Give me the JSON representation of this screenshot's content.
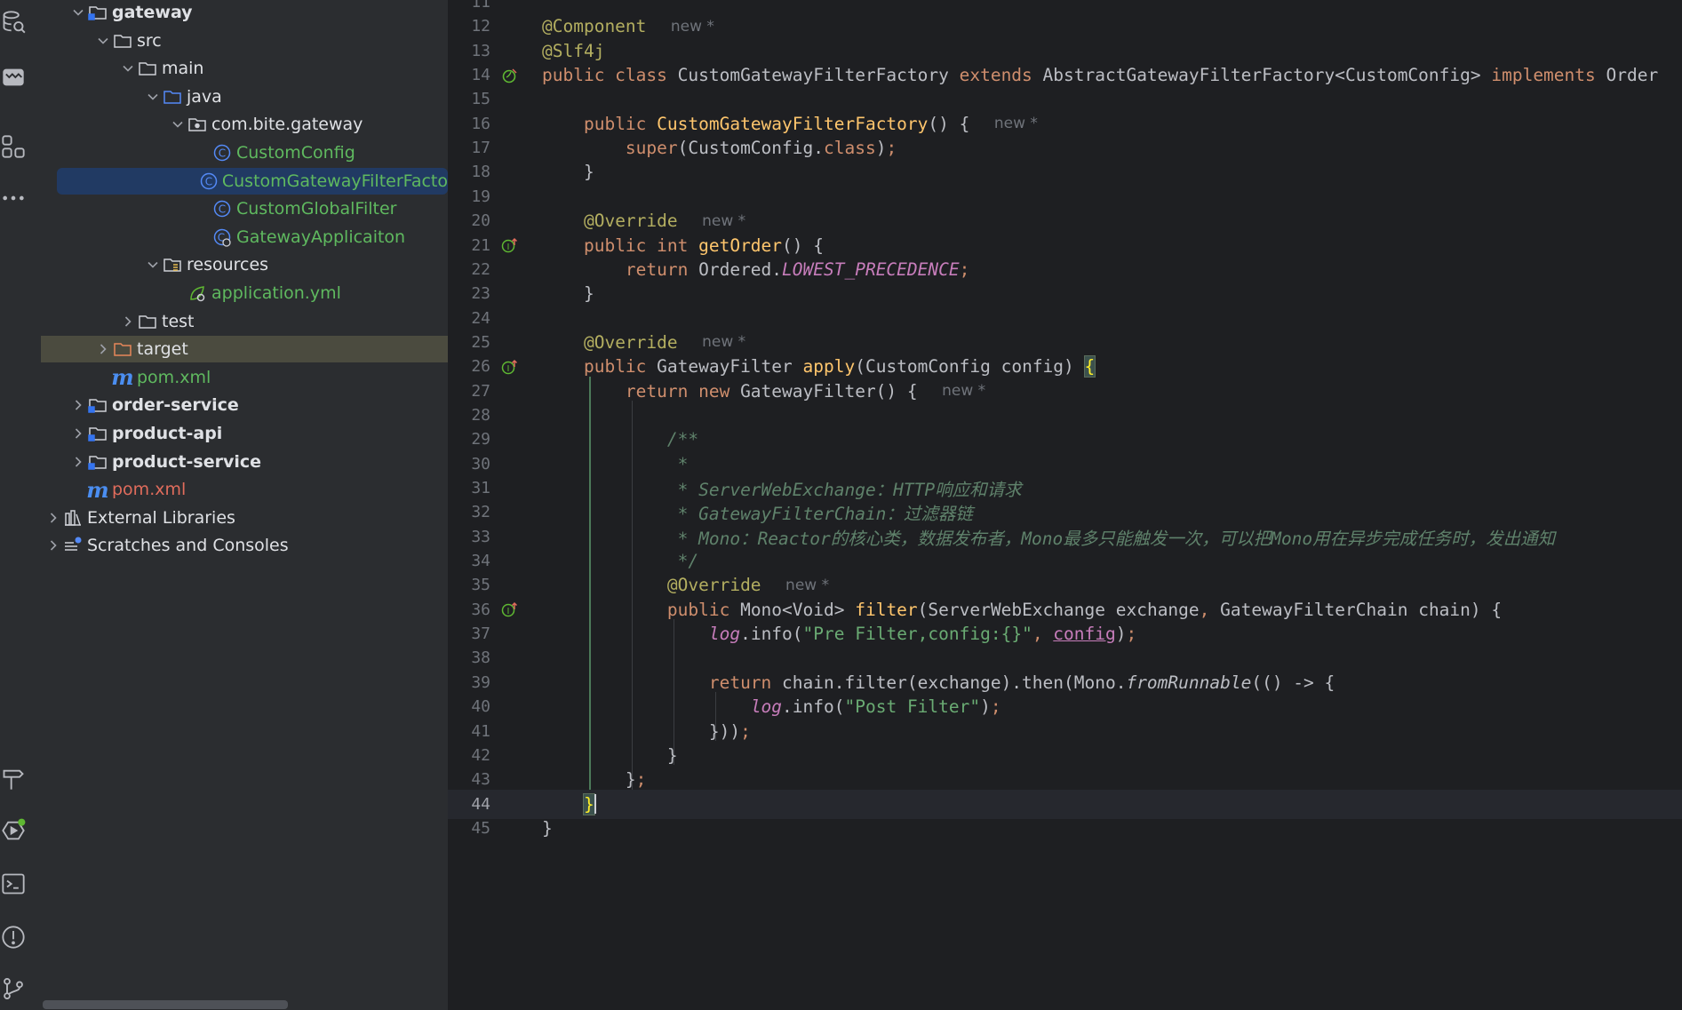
{
  "stripe": {
    "top_icons": [
      "database-icon",
      "ai-assistant-icon",
      "structure-icon",
      "more-icon"
    ],
    "bottom_icons": [
      "build-icon",
      "services-icon",
      "terminal-icon",
      "problems-icon",
      "git-icon"
    ]
  },
  "project_tree": [
    {
      "label": "gateway",
      "chev": "open",
      "icon": "module-folder-icon",
      "style": "bold"
    },
    {
      "label": "src",
      "chev": "open",
      "icon": "folder-icon"
    },
    {
      "label": "main",
      "chev": "open",
      "icon": "folder-icon"
    },
    {
      "label": "java",
      "chev": "open",
      "icon": "source-folder-icon"
    },
    {
      "label": "com.bite.gateway",
      "chev": "open",
      "icon": "package-icon"
    },
    {
      "label": "CustomConfig",
      "icon": "class-icon",
      "style": "green"
    },
    {
      "label": "CustomGatewayFilterFacto",
      "icon": "class-icon",
      "style": "green",
      "selected": true
    },
    {
      "label": "CustomGlobalFilter",
      "icon": "class-icon",
      "style": "green"
    },
    {
      "label": "GatewayApplicaiton",
      "icon": "spring-boot-class-icon",
      "style": "green"
    },
    {
      "label": "resources",
      "chev": "open",
      "icon": "resources-folder-icon"
    },
    {
      "label": "application.yml",
      "icon": "spring-yml-icon",
      "style": "green"
    },
    {
      "label": "test",
      "chev": "closed",
      "icon": "folder-icon"
    },
    {
      "label": "target",
      "chev": "closed",
      "icon": "excluded-folder-icon",
      "highlight": true
    },
    {
      "label": "pom.xml",
      "icon": "maven-icon",
      "style": "green"
    },
    {
      "label": "order-service",
      "chev": "closed",
      "icon": "module-folder-icon",
      "style": "bold"
    },
    {
      "label": "product-api",
      "chev": "closed",
      "icon": "module-folder-icon",
      "style": "bold"
    },
    {
      "label": "product-service",
      "chev": "closed",
      "icon": "module-folder-icon",
      "style": "bold"
    },
    {
      "label": "pom.xml",
      "icon": "maven-icon",
      "style": "red"
    },
    {
      "label": "External Libraries",
      "chev": "closed",
      "icon": "libraries-icon"
    },
    {
      "label": "Scratches and Consoles",
      "chev": "closed",
      "icon": "scratches-icon"
    }
  ],
  "editor": {
    "current_line": 44,
    "lines": [
      {
        "n": "11",
        "t": []
      },
      {
        "n": "12",
        "t": [
          [
            "ann",
            "@Component"
          ],
          [
            "sp",
            "  "
          ],
          [
            "hint",
            "new *"
          ]
        ]
      },
      {
        "n": "13",
        "t": [
          [
            "ann",
            "@Slf4j"
          ]
        ]
      },
      {
        "n": "14",
        "g": "bean-icon",
        "t": [
          [
            "kw",
            "public class "
          ],
          [
            "id",
            "CustomGatewayFilterFactory "
          ],
          [
            "kw",
            "extends "
          ],
          [
            "id",
            "AbstractGatewayFilterFactory<CustomConfig> "
          ],
          [
            "kw",
            "implements "
          ],
          [
            "id",
            "Order"
          ]
        ]
      },
      {
        "n": "15",
        "t": []
      },
      {
        "n": "16",
        "t": [
          [
            "sp",
            "    "
          ],
          [
            "kw",
            "public "
          ],
          [
            "fndecl",
            "CustomGatewayFilterFactory"
          ],
          [
            "id",
            "() {  "
          ],
          [
            "hint",
            "new *"
          ]
        ]
      },
      {
        "n": "17",
        "t": [
          [
            "sp",
            "        "
          ],
          [
            "kw",
            "super"
          ],
          [
            "id",
            "(CustomConfig."
          ],
          [
            "kw",
            "class"
          ],
          [
            "id",
            ")"
          ],
          [
            "kw",
            ";"
          ]
        ]
      },
      {
        "n": "18",
        "t": [
          [
            "sp",
            "    "
          ],
          [
            "id",
            "}"
          ]
        ]
      },
      {
        "n": "19",
        "t": []
      },
      {
        "n": "20",
        "t": [
          [
            "sp",
            "    "
          ],
          [
            "ann",
            "@Override"
          ],
          [
            "sp",
            "  "
          ],
          [
            "hint",
            "new *"
          ]
        ]
      },
      {
        "n": "21",
        "g": "implements-icon",
        "t": [
          [
            "sp",
            "    "
          ],
          [
            "kw",
            "public int "
          ],
          [
            "fndecl",
            "getOrder"
          ],
          [
            "id",
            "() {"
          ]
        ]
      },
      {
        "n": "22",
        "t": [
          [
            "sp",
            "        "
          ],
          [
            "kw",
            "return "
          ],
          [
            "id",
            "Ordered."
          ],
          [
            "konst",
            "LOWEST_PRECEDENCE"
          ],
          [
            "kw",
            ";"
          ]
        ]
      },
      {
        "n": "23",
        "t": [
          [
            "sp",
            "    "
          ],
          [
            "id",
            "}"
          ]
        ]
      },
      {
        "n": "24",
        "t": []
      },
      {
        "n": "25",
        "t": [
          [
            "sp",
            "    "
          ],
          [
            "ann",
            "@Override"
          ],
          [
            "sp",
            "  "
          ],
          [
            "hint",
            "new *"
          ]
        ]
      },
      {
        "n": "26",
        "g": "implements-icon",
        "t": [
          [
            "sp",
            "    "
          ],
          [
            "kw",
            "public "
          ],
          [
            "id",
            "GatewayFilter "
          ],
          [
            "fndecl",
            "apply"
          ],
          [
            "id",
            "(CustomConfig config) "
          ],
          [
            "match",
            "{"
          ]
        ]
      },
      {
        "n": "27",
        "t": [
          [
            "sp",
            "        "
          ],
          [
            "kw",
            "return new "
          ],
          [
            "id",
            "GatewayFilter() {  "
          ],
          [
            "hint",
            "new *"
          ]
        ]
      },
      {
        "n": "28",
        "t": []
      },
      {
        "n": "29",
        "t": [
          [
            "sp",
            "            "
          ],
          [
            "cmt",
            "/**"
          ]
        ]
      },
      {
        "n": "30",
        "t": [
          [
            "sp",
            "             "
          ],
          [
            "cmt",
            "*"
          ]
        ]
      },
      {
        "n": "31",
        "t": [
          [
            "sp",
            "             "
          ],
          [
            "cmt",
            "* ServerWebExchange：HTTP响应和请求"
          ]
        ]
      },
      {
        "n": "32",
        "t": [
          [
            "sp",
            "             "
          ],
          [
            "cmt",
            "* GatewayFilterChain：过滤器链"
          ]
        ]
      },
      {
        "n": "33",
        "t": [
          [
            "sp",
            "             "
          ],
          [
            "cmt",
            "* Mono：Reactor的核心类，数据发布者，Mono最多只能触发一次，可以把Mono用在异步完成任务时，发出通知"
          ]
        ]
      },
      {
        "n": "34",
        "t": [
          [
            "sp",
            "             "
          ],
          [
            "cmt",
            "*/"
          ]
        ]
      },
      {
        "n": "35",
        "t": [
          [
            "sp",
            "            "
          ],
          [
            "ann",
            "@Override"
          ],
          [
            "sp",
            "  "
          ],
          [
            "hint",
            "new *"
          ]
        ]
      },
      {
        "n": "36",
        "g": "implements-icon",
        "t": [
          [
            "sp",
            "            "
          ],
          [
            "kw",
            "public "
          ],
          [
            "id",
            "Mono<Void> "
          ],
          [
            "fndecl",
            "filter"
          ],
          [
            "id",
            "(ServerWebExchange exchange"
          ],
          [
            "kw",
            ", "
          ],
          [
            "id",
            "GatewayFilterChain chain) {"
          ]
        ]
      },
      {
        "n": "37",
        "t": [
          [
            "sp",
            "                "
          ],
          [
            "sfield",
            "log"
          ],
          [
            "id",
            "."
          ],
          [
            "id",
            "info("
          ],
          [
            "str",
            "\"Pre Filter,config:{}\""
          ],
          [
            "kw",
            ", "
          ],
          [
            "field",
            "config"
          ],
          [
            "id",
            ")"
          ],
          [
            "kw",
            ";"
          ]
        ]
      },
      {
        "n": "38",
        "t": []
      },
      {
        "n": "39",
        "t": [
          [
            "sp",
            "                "
          ],
          [
            "kw",
            "return "
          ],
          [
            "id",
            "chain.filter(exchange).then(Mono."
          ],
          [
            "sfield2",
            "fromRunnable"
          ],
          [
            "id",
            "(() -> "
          ],
          [
            "lam",
            "{"
          ]
        ]
      },
      {
        "n": "40",
        "t": [
          [
            "sp",
            "                    "
          ],
          [
            "sfield",
            "log"
          ],
          [
            "id",
            ".info("
          ],
          [
            "str",
            "\"Post Filter\""
          ],
          [
            "id",
            ")"
          ],
          [
            "kw",
            ";"
          ]
        ]
      },
      {
        "n": "41",
        "t": [
          [
            "sp",
            "                "
          ],
          [
            "id",
            "}))"
          ],
          [
            "kw",
            ";"
          ]
        ]
      },
      {
        "n": "42",
        "t": [
          [
            "sp",
            "            "
          ],
          [
            "id",
            "}"
          ]
        ]
      },
      {
        "n": "43",
        "t": [
          [
            "sp",
            "        "
          ],
          [
            "id",
            "}"
          ],
          [
            "kw",
            ";"
          ]
        ]
      },
      {
        "n": "44",
        "t": [
          [
            "sp",
            "    "
          ],
          [
            "match",
            "}"
          ],
          [
            "caret",
            ""
          ]
        ]
      },
      {
        "n": "45",
        "t": [
          [
            "id",
            "}"
          ]
        ]
      }
    ]
  }
}
